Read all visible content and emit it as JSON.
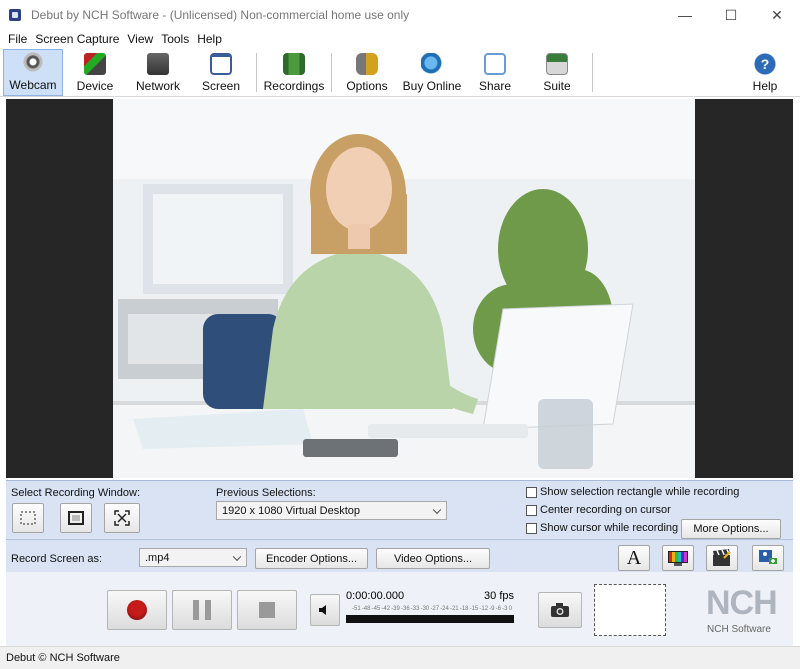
{
  "window": {
    "title": "Debut by NCH Software - (Unlicensed) Non-commercial home use only",
    "minimize": "—",
    "maximize": "☐",
    "close": "✕"
  },
  "menu": [
    "File",
    "Screen Capture",
    "View",
    "Tools",
    "Help"
  ],
  "toolbar": {
    "webcam": "Webcam",
    "device": "Device",
    "network": "Network",
    "screen": "Screen",
    "recordings": "Recordings",
    "options": "Options",
    "buy_online": "Buy Online",
    "share": "Share",
    "suite": "Suite",
    "help": "Help",
    "help_glyph": "?"
  },
  "panel": {
    "select_window_label": "Select Recording Window:",
    "previous_selections_label": "Previous Selections:",
    "previous_selection_value": "1920 x 1080 Virtual Desktop",
    "show_selection_rect": "Show selection rectangle while recording",
    "center_on_cursor": "Center recording on cursor",
    "show_cursor": "Show cursor while recording",
    "more_options": "More Options...",
    "record_as_label": "Record Screen as:",
    "format_value": ".mp4",
    "encoder_options": "Encoder Options...",
    "video_options": "Video Options...",
    "text_tool_glyph": "A"
  },
  "controls": {
    "time": "0:00:00.000",
    "fps": "30 fps",
    "scale": [
      "-51",
      "-48",
      "-45",
      "-42",
      "-39",
      "-36",
      "-33",
      "-30",
      "-27",
      "-24",
      "-21",
      "-18",
      "-15",
      "-12",
      "-9",
      "-6",
      "-3",
      "0"
    ],
    "logo_text": "NCH",
    "logo_caption": "NCH Software"
  },
  "status": "Debut © NCH Software",
  "colors": {
    "accent": "#cde0f7",
    "panel": "#d9e3f3",
    "record": "#c51b1b"
  }
}
